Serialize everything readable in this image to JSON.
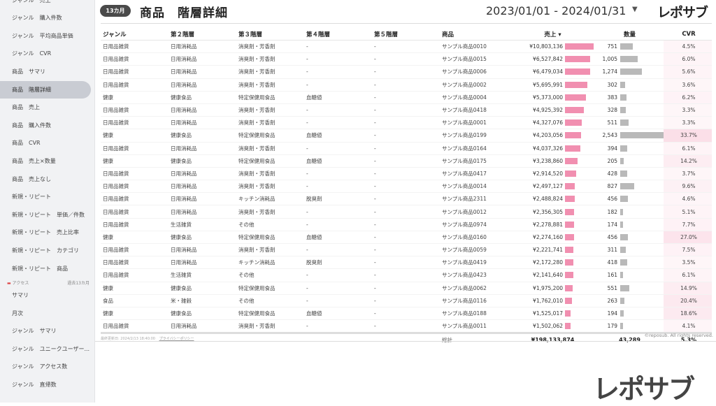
{
  "sidebar": {
    "items": [
      {
        "label": "ジャンル　売上",
        "active": false
      },
      {
        "label": "ジャンル　購入件数",
        "active": false
      },
      {
        "label": "ジャンル　平均商品単価",
        "active": false
      },
      {
        "label": "ジャンル　CVR",
        "active": false
      },
      {
        "label": "商品　サマリ",
        "active": false
      },
      {
        "label": "商品　階層詳細",
        "active": true
      },
      {
        "label": "商品　売上",
        "active": false
      },
      {
        "label": "商品　購入件数",
        "active": false
      },
      {
        "label": "商品　CVR",
        "active": false
      },
      {
        "label": "商品　売上×数量",
        "active": false
      },
      {
        "label": "商品　売上なし",
        "active": false
      },
      {
        "label": "新規・リピート",
        "active": false
      },
      {
        "label": "新規・リピート　単価／件数",
        "active": false
      },
      {
        "label": "新規・リピート　売上比率",
        "active": false
      },
      {
        "label": "新規・リピート　カテゴリ",
        "active": false
      },
      {
        "label": "新規・リピート　商品",
        "active": false
      }
    ],
    "section": {
      "label": "アクセス",
      "right": "過去13カ月"
    },
    "items2": [
      {
        "label": "サマリ"
      },
      {
        "label": "月次"
      },
      {
        "label": "ジャンル　サマリ"
      },
      {
        "label": "ジャンル　ユニークユーザー..."
      },
      {
        "label": "ジャンル　アクセス数"
      },
      {
        "label": "ジャンル　直帰数"
      }
    ]
  },
  "header": {
    "badge": "13カ月",
    "title": "商品　階層詳細",
    "date_range": "2023/01/01 - 2024/01/31",
    "logo": "レポサブ"
  },
  "table": {
    "columns": [
      "ジャンル",
      "第２階層",
      "第３階層",
      "第４階層",
      "第５階層",
      "商品",
      "売上",
      "数量",
      "CVR"
    ],
    "sort_indicator": "▾",
    "max_sales": 10803136,
    "max_qty": 2543,
    "rows": [
      {
        "genre": "日用品雑貨",
        "l2": "日用消耗品",
        "l3": "消臭剤・芳香剤",
        "l4": "-",
        "l5": "-",
        "product": "サンプル商品0010",
        "sales": "¥10,803,136",
        "sales_value": 10803136,
        "qty": "751",
        "qty_value": 751,
        "cvr": "4.5%",
        "cvr_value": 4.5
      },
      {
        "genre": "日用品雑貨",
        "l2": "日用消耗品",
        "l3": "消臭剤・芳香剤",
        "l4": "-",
        "l5": "-",
        "product": "サンプル商品0015",
        "sales": "¥6,527,842",
        "sales_value": 6527842,
        "qty": "1,005",
        "qty_value": 1005,
        "cvr": "6.0%",
        "cvr_value": 6.0
      },
      {
        "genre": "日用品雑貨",
        "l2": "日用消耗品",
        "l3": "消臭剤・芳香剤",
        "l4": "-",
        "l5": "-",
        "product": "サンプル商品0006",
        "sales": "¥6,479,034",
        "sales_value": 6479034,
        "qty": "1,274",
        "qty_value": 1274,
        "cvr": "5.6%",
        "cvr_value": 5.6
      },
      {
        "genre": "日用品雑貨",
        "l2": "日用消耗品",
        "l3": "消臭剤・芳香剤",
        "l4": "-",
        "l5": "-",
        "product": "サンプル商品0002",
        "sales": "¥5,695,991",
        "sales_value": 5695991,
        "qty": "302",
        "qty_value": 302,
        "cvr": "3.6%",
        "cvr_value": 3.6
      },
      {
        "genre": "健康",
        "l2": "健康食品",
        "l3": "特定保健用食品",
        "l4": "血糖値",
        "l5": "-",
        "product": "サンプル商品0004",
        "sales": "¥5,373,000",
        "sales_value": 5373000,
        "qty": "383",
        "qty_value": 383,
        "cvr": "6.2%",
        "cvr_value": 6.2
      },
      {
        "genre": "日用品雑貨",
        "l2": "日用消耗品",
        "l3": "消臭剤・芳香剤",
        "l4": "-",
        "l5": "-",
        "product": "サンプル商品0418",
        "sales": "¥4,925,392",
        "sales_value": 4925392,
        "qty": "328",
        "qty_value": 328,
        "cvr": "3.3%",
        "cvr_value": 3.3
      },
      {
        "genre": "日用品雑貨",
        "l2": "日用消耗品",
        "l3": "消臭剤・芳香剤",
        "l4": "-",
        "l5": "-",
        "product": "サンプル商品0001",
        "sales": "¥4,327,076",
        "sales_value": 4327076,
        "qty": "511",
        "qty_value": 511,
        "cvr": "3.3%",
        "cvr_value": 3.3
      },
      {
        "genre": "健康",
        "l2": "健康食品",
        "l3": "特定保健用食品",
        "l4": "血糖値",
        "l5": "-",
        "product": "サンプル商品0199",
        "sales": "¥4,203,056",
        "sales_value": 4203056,
        "qty": "2,543",
        "qty_value": 2543,
        "cvr": "33.7%",
        "cvr_value": 33.7
      },
      {
        "genre": "日用品雑貨",
        "l2": "日用消耗品",
        "l3": "消臭剤・芳香剤",
        "l4": "-",
        "l5": "-",
        "product": "サンプル商品0164",
        "sales": "¥4,037,326",
        "sales_value": 4037326,
        "qty": "394",
        "qty_value": 394,
        "cvr": "6.1%",
        "cvr_value": 6.1
      },
      {
        "genre": "健康",
        "l2": "健康食品",
        "l3": "特定保健用食品",
        "l4": "血糖値",
        "l5": "-",
        "product": "サンプル商品0175",
        "sales": "¥3,238,860",
        "sales_value": 3238860,
        "qty": "205",
        "qty_value": 205,
        "cvr": "14.2%",
        "cvr_value": 14.2
      },
      {
        "genre": "日用品雑貨",
        "l2": "日用消耗品",
        "l3": "消臭剤・芳香剤",
        "l4": "-",
        "l5": "-",
        "product": "サンプル商品0417",
        "sales": "¥2,914,520",
        "sales_value": 2914520,
        "qty": "428",
        "qty_value": 428,
        "cvr": "3.7%",
        "cvr_value": 3.7
      },
      {
        "genre": "日用品雑貨",
        "l2": "日用消耗品",
        "l3": "消臭剤・芳香剤",
        "l4": "-",
        "l5": "-",
        "product": "サンプル商品0014",
        "sales": "¥2,497,127",
        "sales_value": 2497127,
        "qty": "827",
        "qty_value": 827,
        "cvr": "9.6%",
        "cvr_value": 9.6
      },
      {
        "genre": "日用品雑貨",
        "l2": "日用消耗品",
        "l3": "キッチン消耗品",
        "l4": "脱臭剤",
        "l5": "-",
        "product": "サンプル商品2311",
        "sales": "¥2,488,824",
        "sales_value": 2488824,
        "qty": "456",
        "qty_value": 456,
        "cvr": "4.6%",
        "cvr_value": 4.6
      },
      {
        "genre": "日用品雑貨",
        "l2": "日用消耗品",
        "l3": "消臭剤・芳香剤",
        "l4": "-",
        "l5": "-",
        "product": "サンプル商品0012",
        "sales": "¥2,356,305",
        "sales_value": 2356305,
        "qty": "182",
        "qty_value": 182,
        "cvr": "5.1%",
        "cvr_value": 5.1
      },
      {
        "genre": "日用品雑貨",
        "l2": "生活雑貨",
        "l3": "その他",
        "l4": "-",
        "l5": "-",
        "product": "サンプル商品0974",
        "sales": "¥2,278,881",
        "sales_value": 2278881,
        "qty": "174",
        "qty_value": 174,
        "cvr": "7.7%",
        "cvr_value": 7.7
      },
      {
        "genre": "健康",
        "l2": "健康食品",
        "l3": "特定保健用食品",
        "l4": "血糖値",
        "l5": "-",
        "product": "サンプル商品0160",
        "sales": "¥2,274,160",
        "sales_value": 2274160,
        "qty": "456",
        "qty_value": 456,
        "cvr": "27.0%",
        "cvr_value": 27.0
      },
      {
        "genre": "日用品雑貨",
        "l2": "日用消耗品",
        "l3": "消臭剤・芳香剤",
        "l4": "-",
        "l5": "-",
        "product": "サンプル商品0059",
        "sales": "¥2,221,741",
        "sales_value": 2221741,
        "qty": "311",
        "qty_value": 311,
        "cvr": "7.5%",
        "cvr_value": 7.5
      },
      {
        "genre": "日用品雑貨",
        "l2": "日用消耗品",
        "l3": "キッチン消耗品",
        "l4": "脱臭剤",
        "l5": "-",
        "product": "サンプル商品0419",
        "sales": "¥2,172,280",
        "sales_value": 2172280,
        "qty": "418",
        "qty_value": 418,
        "cvr": "3.5%",
        "cvr_value": 3.5
      },
      {
        "genre": "日用品雑貨",
        "l2": "生活雑貨",
        "l3": "その他",
        "l4": "-",
        "l5": "-",
        "product": "サンプル商品0423",
        "sales": "¥2,141,640",
        "sales_value": 2141640,
        "qty": "161",
        "qty_value": 161,
        "cvr": "6.1%",
        "cvr_value": 6.1
      },
      {
        "genre": "健康",
        "l2": "健康食品",
        "l3": "特定保健用食品",
        "l4": "-",
        "l5": "-",
        "product": "サンプル商品0062",
        "sales": "¥1,975,200",
        "sales_value": 1975200,
        "qty": "551",
        "qty_value": 551,
        "cvr": "14.9%",
        "cvr_value": 14.9
      },
      {
        "genre": "食品",
        "l2": "米・雑穀",
        "l3": "その他",
        "l4": "-",
        "l5": "-",
        "product": "サンプル商品0116",
        "sales": "¥1,762,010",
        "sales_value": 1762010,
        "qty": "263",
        "qty_value": 263,
        "cvr": "20.4%",
        "cvr_value": 20.4
      },
      {
        "genre": "健康",
        "l2": "健康食品",
        "l3": "特定保健用食品",
        "l4": "血糖値",
        "l5": "-",
        "product": "サンプル商品0188",
        "sales": "¥1,525,017",
        "sales_value": 1525017,
        "qty": "194",
        "qty_value": 194,
        "cvr": "18.6%",
        "cvr_value": 18.6
      },
      {
        "genre": "日用品雑貨",
        "l2": "日用消耗品",
        "l3": "消臭剤・芳香剤",
        "l4": "-",
        "l5": "-",
        "product": "サンプル商品0011",
        "sales": "¥1,502,062",
        "sales_value": 1502062,
        "qty": "179",
        "qty_value": 179,
        "cvr": "4.1%",
        "cvr_value": 4.1
      }
    ],
    "total": {
      "label": "総計",
      "sales": "¥198,133,874",
      "qty": "43,289",
      "cvr": "5.3%"
    }
  },
  "footer": {
    "updated": "最終更新日: 2024/2/13 18:40:00",
    "policy": "プライバシーポリシー",
    "copyright": "©reposub. All rights reserved."
  },
  "brand_big": "レポサブ",
  "colors": {
    "sales_bar": "#f18fb0",
    "qty_bar": "#b9b9b9",
    "cvr_heat": "#fbe3ea",
    "sidebar_active": "#c9ccd3",
    "badge_bg": "#4a4a4a"
  }
}
